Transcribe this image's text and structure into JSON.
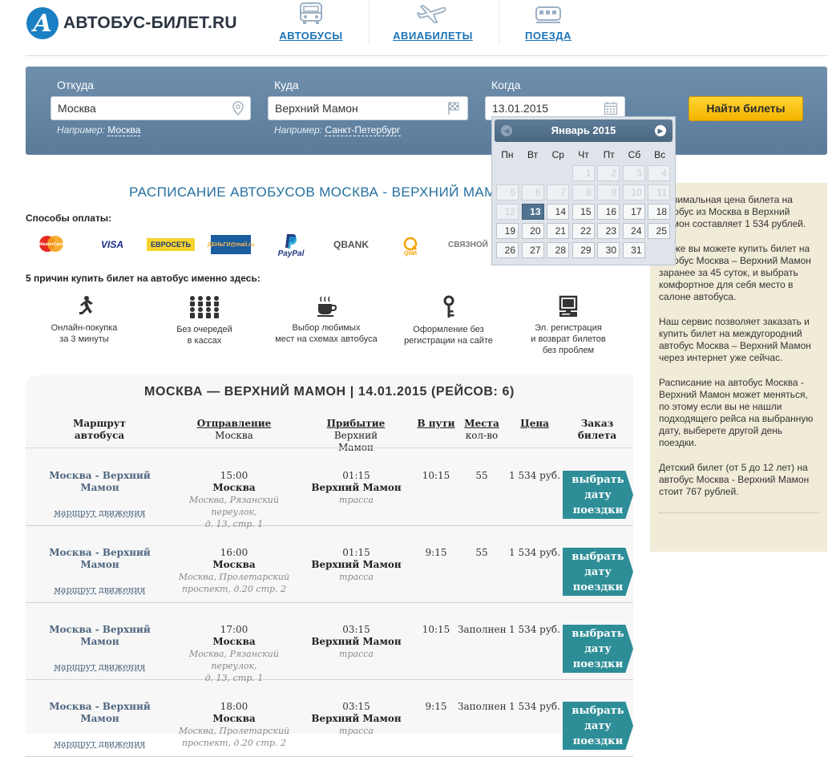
{
  "logo": {
    "letter": "A",
    "text": "АВТОБУС-БИЛЕТ.RU"
  },
  "nav": [
    {
      "label": "АВТОБУСЫ",
      "icon": "bus-icon"
    },
    {
      "label": "АВИАБИЛЕТЫ",
      "icon": "plane-icon"
    },
    {
      "label": "ПОЕЗДА",
      "icon": "train-icon"
    }
  ],
  "search": {
    "from_label": "Откуда",
    "from_value": "Москва",
    "from_hint_prefix": "Например:",
    "from_hint_link": "Москва",
    "to_label": "Куда",
    "to_value": "Верхний Мамон",
    "to_hint_prefix": "Например:",
    "to_hint_link": "Санкт-Петербург",
    "when_label": "Когда",
    "when_value": "13.01.2015",
    "find_button": "Найти билеты"
  },
  "calendar": {
    "month": "Январь 2015",
    "dows": [
      "Пн",
      "Вт",
      "Ср",
      "Чт",
      "Пт",
      "Сб",
      "Вс"
    ],
    "weeks": [
      [
        "",
        "",
        "",
        "1",
        "2",
        "3",
        "4"
      ],
      [
        "5",
        "6",
        "7",
        "8",
        "9",
        "10",
        "11"
      ],
      [
        "12",
        "13",
        "14",
        "15",
        "16",
        "17",
        "18"
      ],
      [
        "19",
        "20",
        "21",
        "22",
        "23",
        "24",
        "25"
      ],
      [
        "26",
        "27",
        "28",
        "29",
        "30",
        "31",
        ""
      ]
    ],
    "selected": "13",
    "first_available": "13"
  },
  "page_title": "РАСПИСАНИЕ АВТОБУСОВ МОСКВА - ВЕРХНИЙ МАМОН",
  "payment": {
    "label": "Способы оплаты:",
    "methods": [
      "MasterCard",
      "VISA",
      "ЕВРОСЕТЬ",
      "ДЕНЬГИ@mail.ru",
      "PayPal",
      "QBANK",
      "QIWI",
      "СВЯЗНОЙ"
    ]
  },
  "reasons": {
    "label": "5 причин купить билет на автобус именно здесь:",
    "items": [
      {
        "icon": "running-man-icon",
        "line1": "Онлайн-покупка",
        "line2": "за 3 минуты",
        "line3": ""
      },
      {
        "icon": "queue-people-icon",
        "line1": "Без очередей",
        "line2": "в кассах",
        "line3": ""
      },
      {
        "icon": "coffee-cup-icon",
        "line1": "Выбор любимых",
        "line2": "мест на схемах автобуса",
        "line3": ""
      },
      {
        "icon": "key-icon",
        "line1": "Оформление без",
        "line2": "регистрации на сайте",
        "line3": ""
      },
      {
        "icon": "computer-icon",
        "line1": "Эл. регистрация",
        "line2": "и возврат билетов",
        "line3": "без проблем"
      }
    ]
  },
  "sidebar": {
    "paragraphs": [
      "Минимальная цена билета на автобус из Москва в Верхний Мамон составляет 1 534 рублей.",
      "Также вы можете купить билет на автобус Москва – Верхний Мамон заранее за 45 суток, и выбрать комфортное для себя место в салоне автобуса.",
      "Наш сервис позволяет заказать и купить билет на междугородний автобус Москва – Верхний Мамон через интернет уже сейчас.",
      "Расписание на автобус Москва - Верхний Мамон может меняться, по этому если вы не нашли подходящего рейса на выбранную дату, выберете другой день поездки.",
      "Детский билет (от 5 до 12 лет) на автобус Москва - Верхний Мамон стоит 767 рублей."
    ]
  },
  "results": {
    "title": "МОСКВА — ВЕРХНИЙ МАМОН | 14.01.2015 (РЕЙСОВ: 6)",
    "headers": {
      "route": [
        "Маршрут",
        "автобуса"
      ],
      "depart": [
        "Отправление",
        "Москва"
      ],
      "arrive": [
        "Прибытие",
        "Верхний Мамон"
      ],
      "duration": "В пути",
      "seats": [
        "Места",
        "кол-во"
      ],
      "price": "Цена",
      "order": [
        "Заказ",
        "билета"
      ]
    },
    "rows": [
      {
        "route": "Москва - Верхний Мамон",
        "map_link": "маршрут движения",
        "dep_time": "15:00",
        "dep_city": "Москва",
        "dep_addr1": "Москва, Рязанский переулок,",
        "dep_addr2": "д. 13, стр. 1",
        "arr_time": "01:15",
        "arr_city": "Верхний Мамон",
        "arr_addr": "трасса",
        "duration": "10:15",
        "seats": "55",
        "price": "1 534 руб.",
        "btn1": "выбрать",
        "btn2": "дату",
        "btn3": "поездки"
      },
      {
        "route": "Москва - Верхний Мамон",
        "map_link": "маршрут движения",
        "dep_time": "16:00",
        "dep_city": "Москва",
        "dep_addr1": "Москва, Пролетарский",
        "dep_addr2": "проспект, д.20 стр. 2",
        "arr_time": "01:15",
        "arr_city": "Верхний Мамон",
        "arr_addr": "трасса",
        "duration": "9:15",
        "seats": "55",
        "price": "1 534 руб.",
        "btn1": "выбрать",
        "btn2": "дату",
        "btn3": "поездки"
      },
      {
        "route": "Москва - Верхний Мамон",
        "map_link": "маршрут движения",
        "dep_time": "17:00",
        "dep_city": "Москва",
        "dep_addr1": "Москва, Рязанский переулок,",
        "dep_addr2": "д. 13, стр. 1",
        "arr_time": "03:15",
        "arr_city": "Верхний Мамон",
        "arr_addr": "трасса",
        "duration": "10:15",
        "seats": "Заполнен",
        "price": "1 534 руб.",
        "btn1": "выбрать",
        "btn2": "дату",
        "btn3": "поездки"
      },
      {
        "route": "Москва - Верхний Мамон",
        "map_link": "маршрут движения",
        "dep_time": "18:00",
        "dep_city": "Москва",
        "dep_addr1": "Москва, Пролетарский",
        "dep_addr2": "проспект, д.20 стр. 2",
        "arr_time": "03:15",
        "arr_city": "Верхний Мамон",
        "arr_addr": "трасса",
        "duration": "9:15",
        "seats": "Заполнен",
        "price": "1 534 руб.",
        "btn1": "выбрать",
        "btn2": "дату",
        "btn3": "поездки"
      }
    ]
  },
  "colors": {
    "accent": "#1b73b8",
    "search_bar": "#6283a3",
    "find_button": "#f7c21a",
    "select_button": "#2e8e98",
    "sidebar_bg": "#f1ecd8"
  }
}
